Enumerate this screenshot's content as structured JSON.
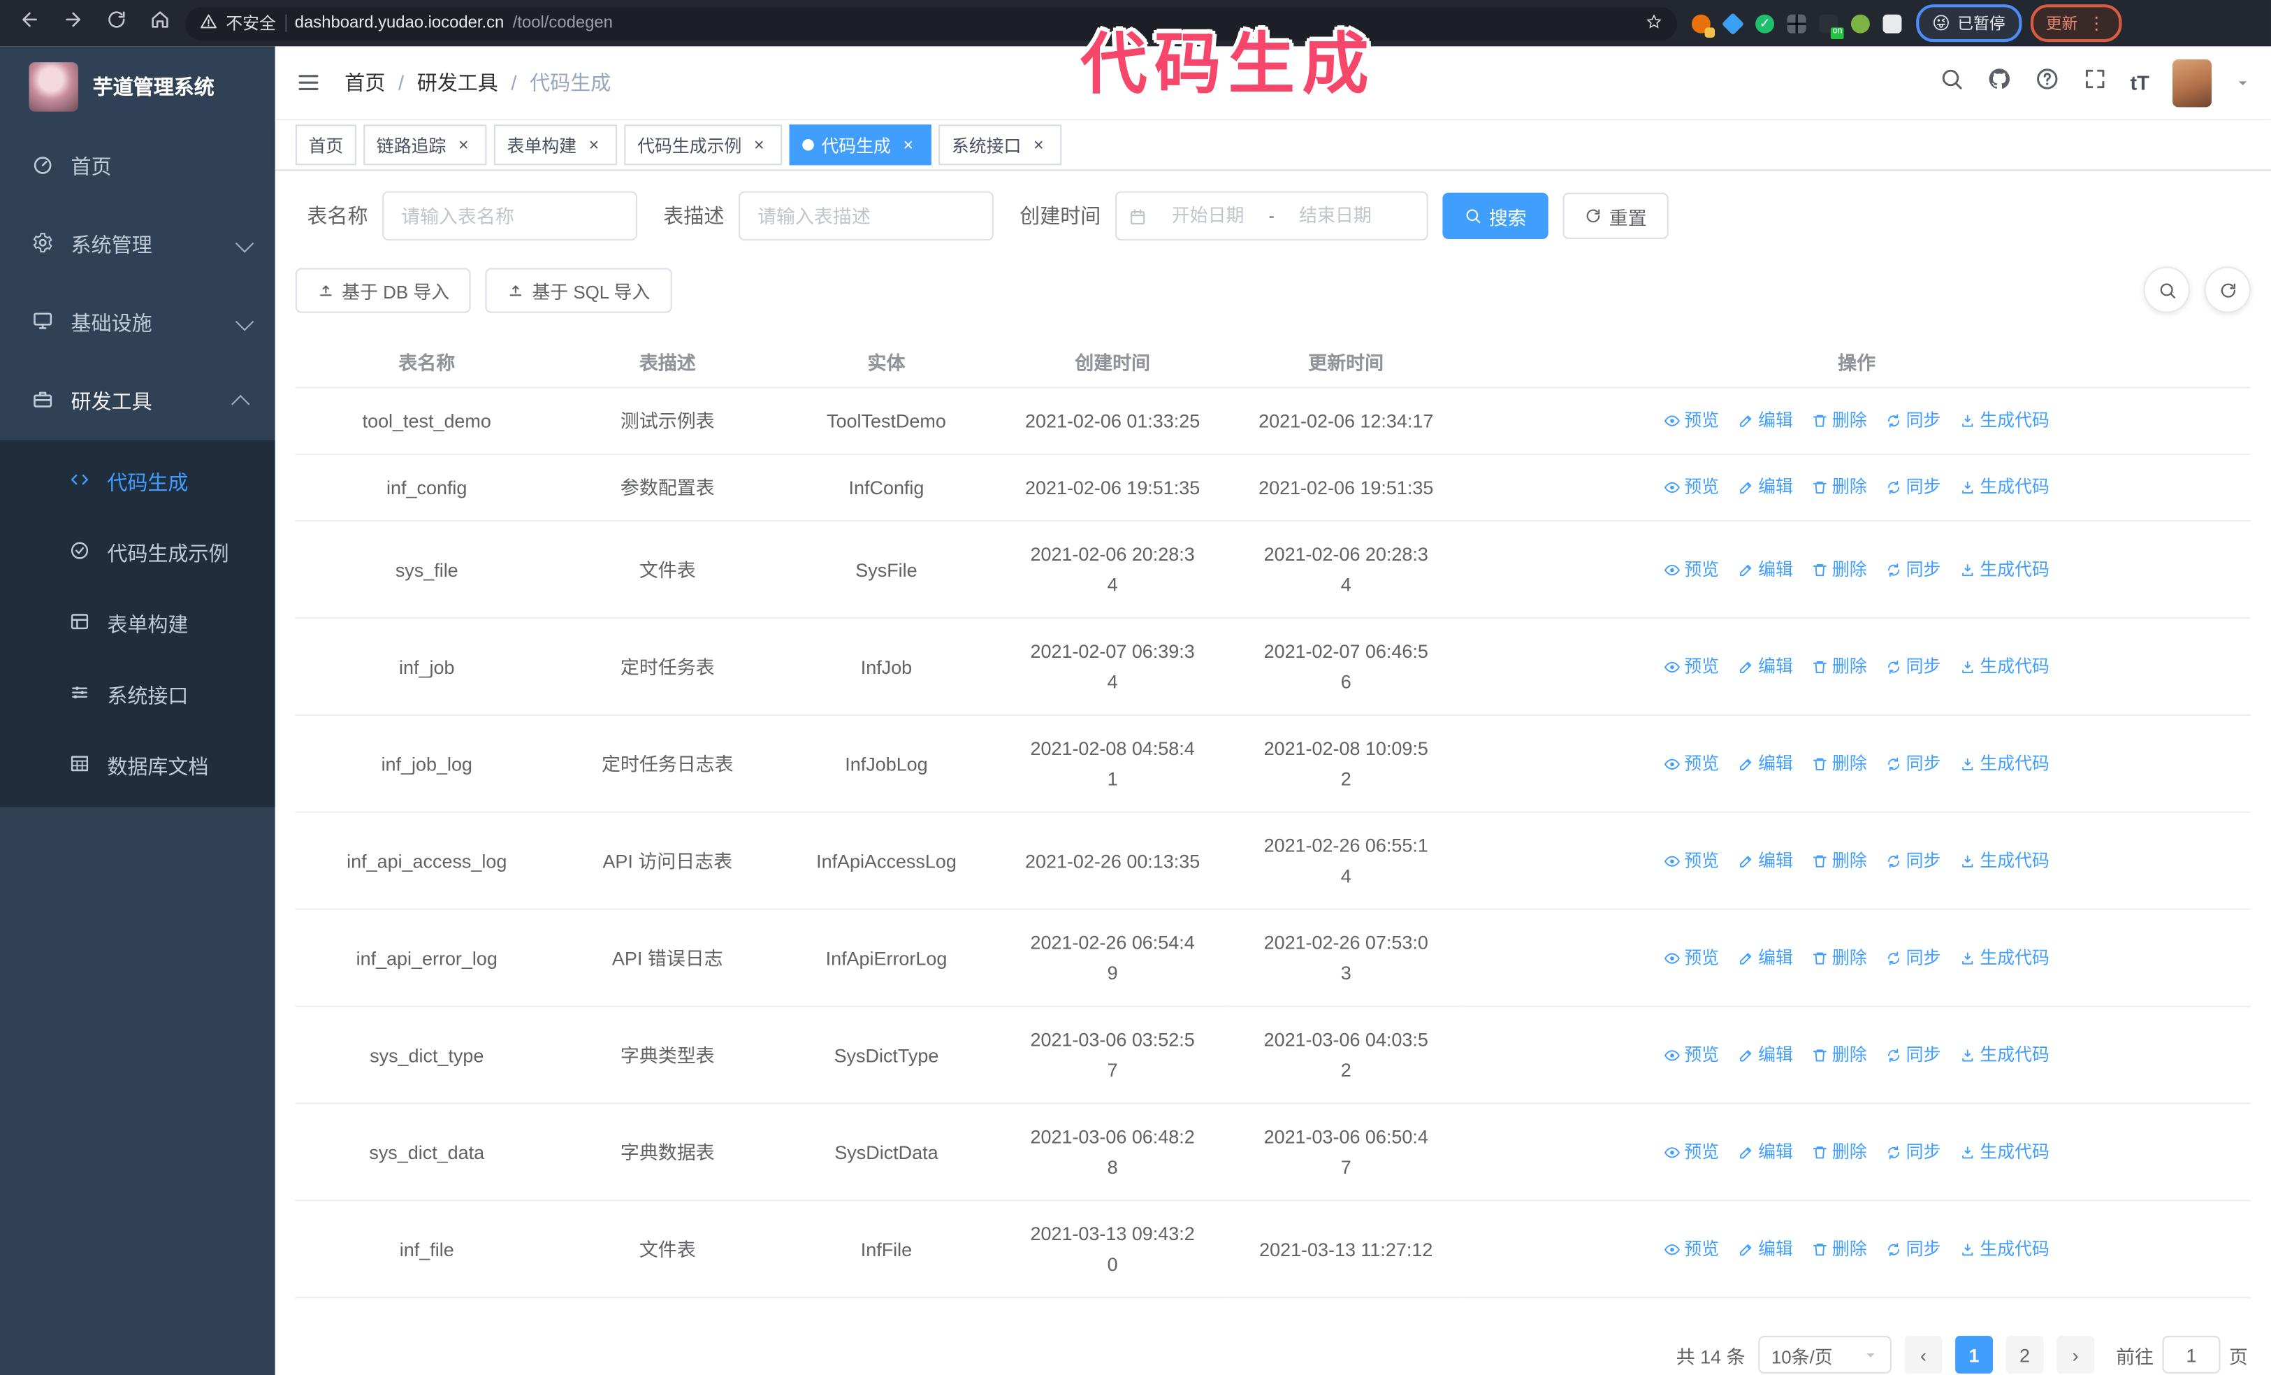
{
  "browser": {
    "security_label": "不安全",
    "url_host": "dashboard.yudao.iocoder.cn",
    "url_path": "/tool/codegen",
    "paused_emoji": "😜",
    "paused_label": "已暂停",
    "update_label": "更新",
    "extensions": [
      {
        "id": "ext-orange-c",
        "shape": "circle",
        "color": "#e8710a",
        "badge": "#f7c04a"
      },
      {
        "id": "ext-blue-gem",
        "shape": "diamond",
        "color": "#3aa0f3"
      },
      {
        "id": "ext-green-check",
        "shape": "circle",
        "color": "#1fbf6b",
        "inner": "✓"
      },
      {
        "id": "ext-grid",
        "shape": "grid",
        "color": "#9aa0a6"
      },
      {
        "id": "ext-on-switch",
        "shape": "square",
        "color": "#2b2f36",
        "badge_text": "on",
        "badge_color": "#23c343"
      },
      {
        "id": "ext-green",
        "shape": "circle",
        "color": "#7cb342"
      },
      {
        "id": "ext-puzzle",
        "shape": "square",
        "color": "#e8eaed"
      }
    ]
  },
  "app": {
    "title": "芋道管理系统"
  },
  "sidebar": {
    "items": [
      {
        "id": "home",
        "label": "首页",
        "icon": "dashboard-icon"
      },
      {
        "id": "system",
        "label": "系统管理",
        "icon": "gear-icon",
        "chevron": "down"
      },
      {
        "id": "infra",
        "label": "基础设施",
        "icon": "monitor-icon",
        "chevron": "down"
      },
      {
        "id": "devtools",
        "label": "研发工具",
        "icon": "toolbox-icon",
        "chevron": "up",
        "expanded": true
      }
    ],
    "sub_items": [
      {
        "id": "codegen",
        "label": "代码生成",
        "icon": "code-icon",
        "active": true
      },
      {
        "id": "codegen-example",
        "label": "代码生成示例",
        "icon": "badge-check-icon"
      },
      {
        "id": "form-builder",
        "label": "表单构建",
        "icon": "form-grid-icon"
      },
      {
        "id": "system-api",
        "label": "系统接口",
        "icon": "sliders-icon"
      },
      {
        "id": "db-doc",
        "label": "数据库文档",
        "icon": "database-icon"
      }
    ]
  },
  "header": {
    "breadcrumb": [
      "首页",
      "研发工具",
      "代码生成"
    ],
    "separator": "/"
  },
  "tabs": [
    {
      "label": "首页",
      "closable": false,
      "active": false
    },
    {
      "label": "链路追踪",
      "closable": true,
      "active": false
    },
    {
      "label": "表单构建",
      "closable": true,
      "active": false
    },
    {
      "label": "代码生成示例",
      "closable": true,
      "active": false
    },
    {
      "label": "代码生成",
      "closable": true,
      "active": true
    },
    {
      "label": "系统接口",
      "closable": true,
      "active": false
    }
  ],
  "filters": {
    "name_label": "表名称",
    "name_placeholder": "请输入表名称",
    "desc_label": "表描述",
    "desc_placeholder": "请输入表描述",
    "time_label": "创建时间",
    "start_placeholder": "开始日期",
    "range_separator": "-",
    "end_placeholder": "结束日期",
    "search_label": "搜索",
    "reset_label": "重置"
  },
  "import_buttons": {
    "db": "基于 DB 导入",
    "sql": "基于 SQL 导入"
  },
  "table": {
    "columns": [
      "表名称",
      "表描述",
      "实体",
      "创建时间",
      "更新时间",
      "操作"
    ],
    "column_ids": [
      "name",
      "desc",
      "entity",
      "create-time",
      "update-time",
      "operations"
    ],
    "actions": [
      {
        "id": "preview",
        "label": "预览",
        "icon": "eye-icon"
      },
      {
        "id": "edit",
        "label": "编辑",
        "icon": "edit-icon"
      },
      {
        "id": "delete",
        "label": "删除",
        "icon": "delete-icon"
      },
      {
        "id": "sync",
        "label": "同步",
        "icon": "sync-icon"
      },
      {
        "id": "generate",
        "label": "生成代码",
        "icon": "download-icon"
      }
    ],
    "rows": [
      {
        "name": "tool_test_demo",
        "desc": "测试示例表",
        "entity": "ToolTestDemo",
        "created": "2021-02-06 01:33:25",
        "updated": "2021-02-06 12:34:17"
      },
      {
        "name": "inf_config",
        "desc": "参数配置表",
        "entity": "InfConfig",
        "created": "2021-02-06 19:51:35",
        "updated": "2021-02-06 19:51:35"
      },
      {
        "name": "sys_file",
        "desc": "文件表",
        "entity": "SysFile",
        "created": "2021-02-06 20:28:3\n4",
        "updated": "2021-02-06 20:28:3\n4"
      },
      {
        "name": "inf_job",
        "desc": "定时任务表",
        "entity": "InfJob",
        "created": "2021-02-07 06:39:3\n4",
        "updated": "2021-02-07 06:46:5\n6"
      },
      {
        "name": "inf_job_log",
        "desc": "定时任务日志表",
        "entity": "InfJobLog",
        "created": "2021-02-08 04:58:4\n1",
        "updated": "2021-02-08 10:09:5\n2"
      },
      {
        "name": "inf_api_access_log",
        "desc": "API 访问日志表",
        "entity": "InfApiAccessLog",
        "created": "2021-02-26 00:13:35",
        "updated": "2021-02-26 06:55:1\n4"
      },
      {
        "name": "inf_api_error_log",
        "desc": "API 错误日志",
        "entity": "InfApiErrorLog",
        "created": "2021-02-26 06:54:4\n9",
        "updated": "2021-02-26 07:53:0\n3"
      },
      {
        "name": "sys_dict_type",
        "desc": "字典类型表",
        "entity": "SysDictType",
        "created": "2021-03-06 03:52:5\n7",
        "updated": "2021-03-06 04:03:5\n2"
      },
      {
        "name": "sys_dict_data",
        "desc": "字典数据表",
        "entity": "SysDictData",
        "created": "2021-03-06 06:48:2\n8",
        "updated": "2021-03-06 06:50:4\n7"
      },
      {
        "name": "inf_file",
        "desc": "文件表",
        "entity": "InfFile",
        "created": "2021-03-13 09:43:2\n0",
        "updated": "2021-03-13 11:27:12"
      }
    ]
  },
  "pagination": {
    "total": "共 14 条",
    "page_size": "10条/页",
    "prev": "‹",
    "next": "›",
    "pages": [
      "1",
      "2"
    ],
    "active_page": "1",
    "goto_label": "前往",
    "goto_value": "1",
    "goto_suffix": "页"
  },
  "watermark": "代码生成",
  "colors": {
    "primary": "#409eff",
    "watermark": "#f6476b",
    "sidebar_bg": "#304156",
    "submenu_bg": "#1f2d3d"
  }
}
